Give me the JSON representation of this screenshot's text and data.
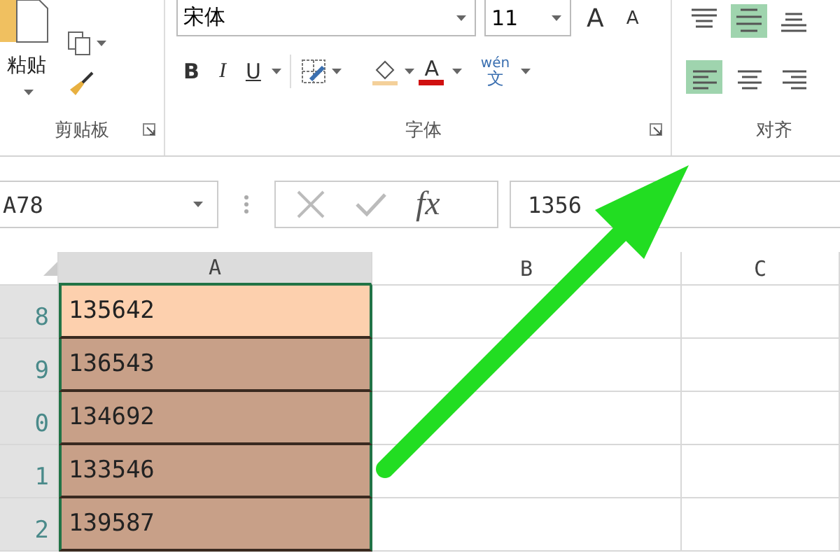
{
  "ribbon": {
    "clipboard": {
      "paste_label": "粘贴",
      "group_label": "剪贴板"
    },
    "font": {
      "font_name": "宋体",
      "font_size": "11",
      "grow_label": "A",
      "shrink_label": "A",
      "bold_label": "B",
      "italic_label": "I",
      "underline_label": "U",
      "font_color_label": "A",
      "phonetic_top": "wén",
      "phonetic_bottom": "文",
      "group_label": "字体"
    },
    "alignment": {
      "group_label": "对齐",
      "buttons": [
        {
          "kind": "top",
          "selected": false
        },
        {
          "kind": "middle",
          "selected": true
        },
        {
          "kind": "bottom",
          "selected": false
        },
        {
          "kind": "left",
          "selected": true
        },
        {
          "kind": "center",
          "selected": false
        },
        {
          "kind": "right",
          "selected": false
        }
      ]
    }
  },
  "formula_bar": {
    "name_box": "A78",
    "function_label": "fx",
    "value": "1356"
  },
  "grid": {
    "columns": [
      {
        "label": "A",
        "selected": true
      },
      {
        "label": "B",
        "selected": false
      },
      {
        "label": "C",
        "selected": false
      }
    ],
    "rows": [
      {
        "header": "8",
        "value": "135642",
        "selected": true,
        "active": true
      },
      {
        "header": "9",
        "value": "136543",
        "selected": true,
        "active": false
      },
      {
        "header": "0",
        "value": "134692",
        "selected": true,
        "active": false
      },
      {
        "header": "1",
        "value": "133546",
        "selected": true,
        "active": false
      },
      {
        "header": "2",
        "value": "139587",
        "selected": true,
        "active": false
      }
    ]
  }
}
